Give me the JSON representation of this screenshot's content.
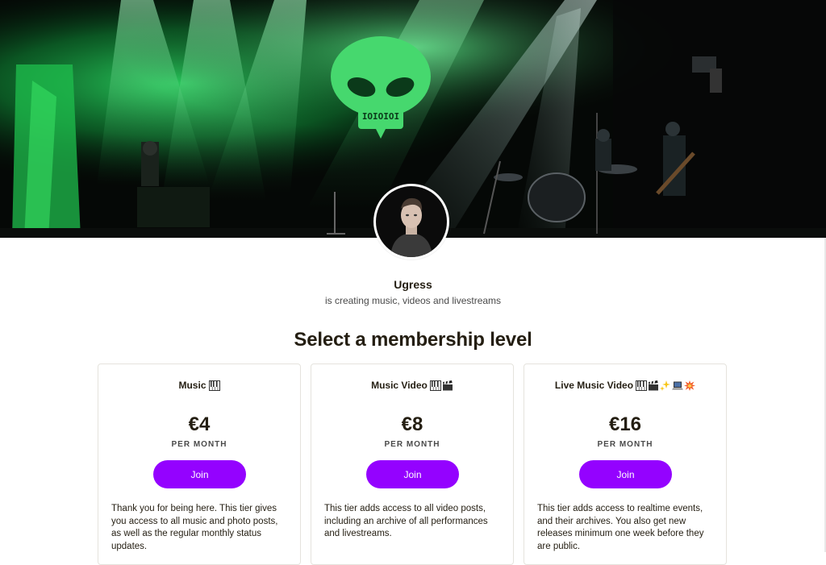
{
  "banner": {
    "alt": "Concert stage with green lights",
    "logo_text": "IOIOIOI"
  },
  "creator": {
    "name": "Ugress",
    "tagline": "is creating music, videos and livestreams"
  },
  "page": {
    "heading": "Select a membership level"
  },
  "colors": {
    "accent": "#9402ff",
    "text": "#241e12",
    "border": "#e5e3dd"
  },
  "tiers": [
    {
      "title": "Music",
      "icons": [
        "piano-keys-icon"
      ],
      "price": "€4",
      "period": "PER MONTH",
      "button": "Join",
      "description": "Thank you for being here. This tier gives you access to all music and photo posts, as well as the regular monthly status updates."
    },
    {
      "title": "Music Video",
      "icons": [
        "piano-keys-icon",
        "clapper-board-icon"
      ],
      "price": "€8",
      "period": "PER MONTH",
      "button": "Join",
      "description": "This tier adds access to all video posts, including an archive of all performances and livestreams."
    },
    {
      "title": "Live Music Video",
      "icons": [
        "piano-keys-icon",
        "clapper-board-icon",
        "sparkles-icon",
        "laptop-icon",
        "collision-icon"
      ],
      "price": "€16",
      "period": "PER MONTH",
      "button": "Join",
      "description": "This tier adds access to realtime events, and their archives. You also get new releases minimum one week before they are public."
    }
  ]
}
